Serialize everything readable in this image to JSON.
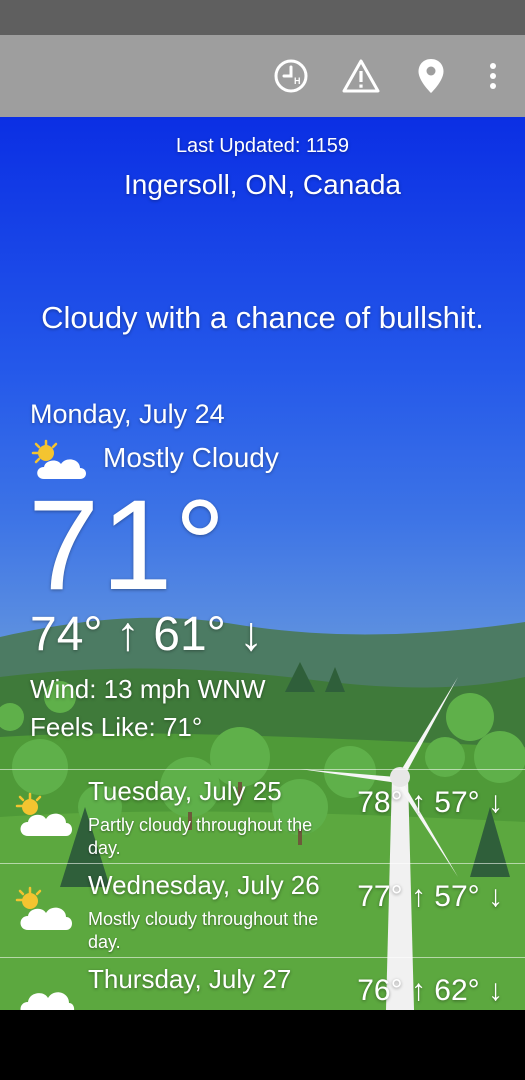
{
  "toolbar": {
    "icons": [
      "hourly-clock-icon",
      "alert-triangle-icon",
      "location-pin-icon",
      "more-vertical-icon"
    ]
  },
  "header": {
    "last_updated": "Last Updated: 1159",
    "location": "Ingersoll, ON, Canada"
  },
  "slogan": "Cloudy with a chance of bullshit.",
  "today": {
    "date": "Monday, July 24",
    "icon": "partly-cloudy-icon",
    "condition": "Mostly Cloudy",
    "temperature": "71°",
    "high_low": "74° ↑ 61° ↓",
    "wind": "Wind: 13 mph WNW",
    "feels_like": "Feels Like: 71°"
  },
  "forecast": [
    {
      "day": "Tuesday, July 25",
      "description": "Partly cloudy throughout the day.",
      "high_low": "78° ↑ 57° ↓",
      "icon": "partly-cloudy-icon"
    },
    {
      "day": "Wednesday, July 26",
      "description": "Mostly cloudy throughout the day.",
      "high_low": "77° ↑ 57° ↓",
      "icon": "partly-cloudy-icon"
    },
    {
      "day": "Thursday, July 27",
      "description": "",
      "high_low": "76° ↑ 62° ↓",
      "icon": "cloud-icon"
    }
  ],
  "colors": {
    "sky_top": "#0b2fe4",
    "sky_bottom": "#9ab9d8",
    "grass": "#4f9a38",
    "toolbar": "#9e9e9e",
    "status_bar": "#5f5f5f"
  }
}
